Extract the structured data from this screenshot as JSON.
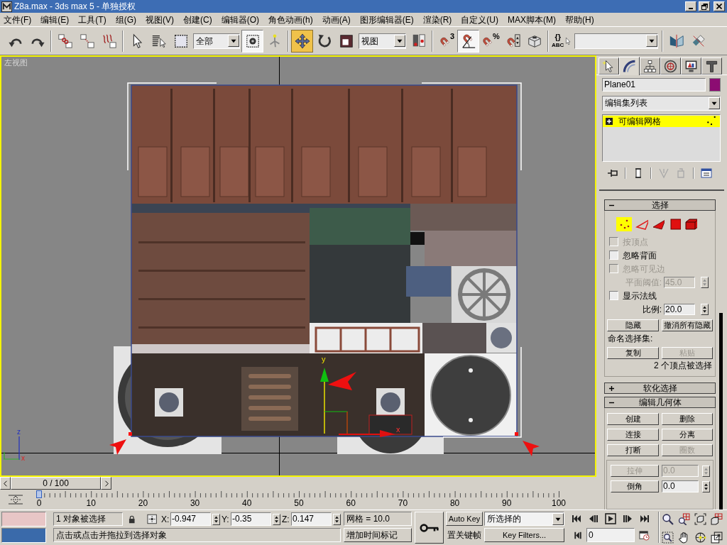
{
  "window": {
    "title": "Z8a.max - 3ds max 5 - 单独授权"
  },
  "menu": [
    "文件(F)",
    "编辑(E)",
    "工具(T)",
    "组(G)",
    "视图(V)",
    "创建(C)",
    "编辑器(O)",
    "角色动画(h)",
    "动画(A)",
    "图形编辑器(E)",
    "渲染(R)",
    "自定义(U)",
    "MAX脚本(M)",
    "帮助(H)"
  ],
  "toolbar": {
    "groups": [
      [
        {
          "kind": "button",
          "selected": false,
          "pressed": false
        },
        {
          "kind": "button",
          "selected": false,
          "pressed": false
        }
      ],
      [
        {
          "kind": "button",
          "selected": false,
          "pressed": false
        },
        {
          "kind": "button",
          "selected": false,
          "pressed": false
        },
        {
          "kind": "button",
          "selected": false,
          "pressed": false
        }
      ],
      [
        {
          "kind": "button",
          "selected": false,
          "pressed": false
        },
        {
          "kind": "button",
          "selected": false,
          "pressed": false
        },
        {
          "kind": "button",
          "selected": false,
          "pressed": false
        },
        {
          "kind": "dropdown",
          "value": "全部"
        },
        {
          "kind": "button",
          "selected": false,
          "pressed": true
        },
        {
          "kind": "button",
          "selected": false,
          "pressed": false
        }
      ],
      [
        {
          "kind": "button",
          "selected": true,
          "pressed": false
        },
        {
          "kind": "button",
          "selected": false,
          "pressed": false
        },
        {
          "kind": "button",
          "selected": false,
          "pressed": false
        },
        {
          "kind": "dropdown",
          "value": "视图"
        },
        {
          "kind": "button",
          "selected": false,
          "pressed": false
        }
      ],
      [
        {
          "kind": "button",
          "selected": false,
          "pressed": false,
          "labels": [
            "3"
          ]
        },
        {
          "kind": "button",
          "selected": false,
          "pressed": true
        },
        {
          "kind": "button",
          "selected": false,
          "pressed": false,
          "labels": [
            "%"
          ]
        },
        {
          "kind": "button",
          "selected": false,
          "pressed": false
        },
        {
          "kind": "button",
          "selected": false,
          "pressed": false
        }
      ],
      [
        {
          "kind": "button",
          "selected": false,
          "pressed": false,
          "labels": [
            "{}",
            "ABC"
          ]
        },
        {
          "kind": "dropdown"
        }
      ],
      [
        {
          "kind": "button",
          "selected": false,
          "pressed": false
        },
        {
          "kind": "button",
          "selected": false,
          "pressed": false
        }
      ]
    ]
  },
  "viewport": {
    "label": "左视图",
    "active": true,
    "gizmo_labels": [
      "y",
      "x"
    ],
    "tripod_labels": [
      "z",
      "x"
    ]
  },
  "command_panel": {
    "tabs": [
      {
        "selected": false
      },
      {
        "selected": true
      },
      {
        "selected": false
      },
      {
        "selected": false
      },
      {
        "selected": false
      },
      {
        "selected": false
      }
    ],
    "object": {
      "name": "Plane01",
      "color": "#8c0c72"
    },
    "modifier_list": "编辑集列表",
    "stack": [
      {
        "label": "可编辑网格",
        "selected": true,
        "expanded": false
      }
    ],
    "stack_buttons": [
      {
        "disabled": false
      },
      {
        "disabled": false
      },
      {
        "disabled": true
      },
      {
        "disabled": true
      },
      {
        "disabled": false
      }
    ],
    "rollouts": [
      {
        "kind": "selection",
        "title": "选择",
        "expanded": true,
        "subobjects": [
          {
            "selected": true
          },
          {
            "selected": false
          },
          {
            "selected": false
          },
          {
            "selected": false
          },
          {
            "selected": false
          }
        ],
        "options": [
          {
            "kind": "checkbox",
            "label": "按顶点",
            "checked": false,
            "disabled": true
          },
          {
            "kind": "checkbox",
            "label": "忽略背面",
            "checked": false,
            "disabled": false
          },
          {
            "kind": "checkbox",
            "label": "忽略可见边",
            "checked": false,
            "disabled": true
          },
          {
            "kind": "spinner",
            "label": "平面阈值:",
            "value": "45.0",
            "disabled": true
          },
          {
            "kind": "checkbox",
            "label": "显示法线",
            "checked": false,
            "disabled": false
          },
          {
            "kind": "spinner",
            "label": "比例:",
            "value": "20.0",
            "disabled": false
          }
        ],
        "buttons": [
          {
            "label": "隐藏",
            "disabled": false
          },
          {
            "label": "撤消所有隐藏",
            "disabled": false
          }
        ],
        "named_sets_label": "命名选择集:",
        "named_sets_buttons": [
          {
            "label": "复制",
            "disabled": false
          },
          {
            "label": "粘贴",
            "disabled": true
          }
        ],
        "status": "2 个顶点被选择"
      },
      {
        "title": "软化选择",
        "expanded": false
      },
      {
        "kind": "edit_geometry",
        "title": "编辑几何体",
        "expanded": true,
        "buttons": [
          {
            "label": "创建",
            "disabled": false
          },
          {
            "label": "删除",
            "disabled": false
          },
          {
            "label": "连接",
            "disabled": false
          },
          {
            "label": "分离",
            "disabled": false
          },
          {
            "label": "打断",
            "disabled": false
          },
          {
            "label": "圈数",
            "disabled": true
          }
        ],
        "spinners": [
          {
            "label": "拉伸",
            "value": "0.0",
            "disabled": true
          },
          {
            "label": "倒角",
            "value": "0.0",
            "disabled": false
          }
        ]
      }
    ]
  },
  "time_slider": {
    "label": "0 / 100",
    "level": 0
  },
  "track_bar": {
    "ticks": [
      "0",
      "10",
      "20",
      "30",
      "40",
      "50",
      "60",
      "70",
      "80",
      "90",
      "100"
    ]
  },
  "status_bar": {
    "selection": "1 对象被选择",
    "coords": [
      {
        "axis": "X:",
        "value": "-0.947"
      },
      {
        "axis": "Y:",
        "value": "-0.35"
      },
      {
        "axis": "Z:",
        "value": "0.147"
      }
    ],
    "grid": "网格 = 10.0",
    "prompt": "点击或点击并拖拉到选择对象",
    "time_tag": "增加时间标记",
    "auto_key": {
      "label": "Auto Key",
      "on": false
    },
    "set_key": "置关键帧",
    "key_mode": "所选择的",
    "key_filters": "Key Filters...",
    "frame": "0"
  }
}
